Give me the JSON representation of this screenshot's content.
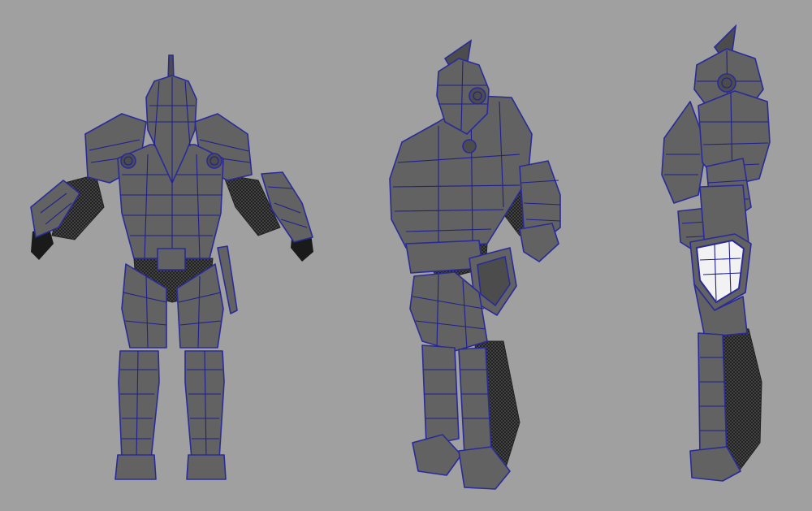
{
  "scene": {
    "description_free": true,
    "background_color": "#a0a0a0",
    "armor_color": "#626262",
    "wire_color": "#2a2a9a",
    "mesh_color": "#1e1e1e",
    "views": [
      "front",
      "three-quarter",
      "side"
    ]
  }
}
